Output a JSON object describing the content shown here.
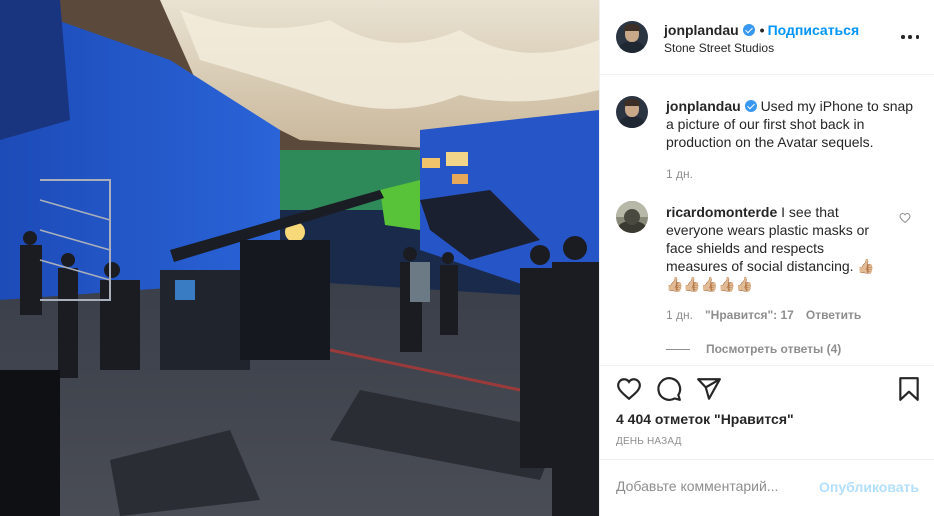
{
  "header": {
    "username": "jonplandau",
    "separator": "•",
    "follow_label": "Подписаться",
    "location": "Stone Street Studios"
  },
  "caption": {
    "username": "jonplandau",
    "text": "Used my iPhone to snap a picture of our first shot back in production on the Avatar sequels.",
    "time": "1 дн."
  },
  "comments": [
    {
      "username": "ricardomonterde",
      "text": "I see that everyone wears plastic masks or face shields and respects measures of social distancing. 👍🏼 👍🏼👍🏼👍🏼👍🏼👍🏼",
      "time": "1 дн.",
      "likes": "\"Нравится\": 17",
      "reply_label": "Ответить",
      "view_replies": "Посмотреть ответы (4)"
    }
  ],
  "likes_count": "4 404 отметок \"Нравится\"",
  "post_time": "ДЕНЬ НАЗАД",
  "add_comment": {
    "placeholder": "Добавьте комментарий...",
    "publish_label": "Опубликовать"
  },
  "icons": {
    "verified": "verified-badge-icon",
    "more": "more-options-icon",
    "like": "heart-icon",
    "comment": "comment-icon",
    "share": "share-icon",
    "save": "bookmark-icon"
  },
  "colors": {
    "accent": "#0095f6",
    "verified": "#3897f0",
    "publish_disabled": "#b2dffc",
    "muted": "#8e8e8e"
  }
}
